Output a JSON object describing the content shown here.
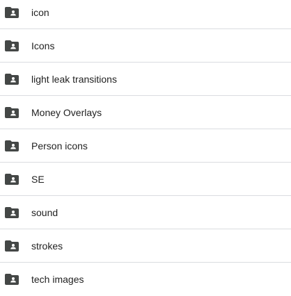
{
  "folders": [
    {
      "name": "icon",
      "icon": "shared-folder-icon"
    },
    {
      "name": "Icons",
      "icon": "shared-folder-icon"
    },
    {
      "name": "light leak transitions",
      "icon": "shared-folder-icon"
    },
    {
      "name": "Money Overlays",
      "icon": "shared-folder-icon"
    },
    {
      "name": "Person icons",
      "icon": "shared-folder-icon"
    },
    {
      "name": "SE",
      "icon": "shared-folder-icon"
    },
    {
      "name": "sound",
      "icon": "shared-folder-icon"
    },
    {
      "name": "strokes",
      "icon": "shared-folder-icon"
    },
    {
      "name": "tech images",
      "icon": "shared-folder-icon"
    }
  ],
  "colors": {
    "icon": "#444746",
    "text": "#1f1f1f",
    "divider": "#dadce0"
  }
}
